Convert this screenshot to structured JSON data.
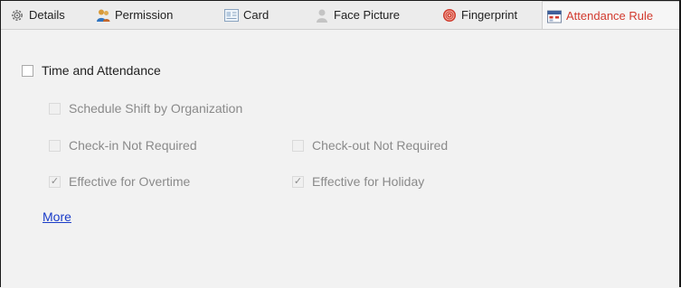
{
  "tabs": [
    {
      "label": "Details",
      "icon": "gear-icon"
    },
    {
      "label": "Permission",
      "icon": "users-icon"
    },
    {
      "label": "Card",
      "icon": "id-card-icon"
    },
    {
      "label": "Face Picture",
      "icon": "person-icon"
    },
    {
      "label": "Fingerprint",
      "icon": "fingerprint-icon"
    },
    {
      "label": "Attendance Rule",
      "icon": "calendar-icon",
      "active": true
    }
  ],
  "colors": {
    "active_tab_text": "#d23a2e",
    "link": "#1a3cc8",
    "disabled_text": "#8a8a8a",
    "background": "#f2f2f2"
  },
  "attendance": {
    "main_checkbox": {
      "label": "Time and Attendance",
      "checked": false
    },
    "schedule_shift": {
      "label": "Schedule Shift by Organization",
      "checked": false,
      "disabled": true
    },
    "checkin_not_required": {
      "label": "Check-in Not Required",
      "checked": false,
      "disabled": true
    },
    "checkout_not_required": {
      "label": "Check-out Not Required",
      "checked": false,
      "disabled": true
    },
    "effective_overtime": {
      "label": "Effective for Overtime",
      "checked": true,
      "disabled": true
    },
    "effective_holiday": {
      "label": "Effective for Holiday",
      "checked": true,
      "disabled": true
    },
    "more_link": "More"
  }
}
